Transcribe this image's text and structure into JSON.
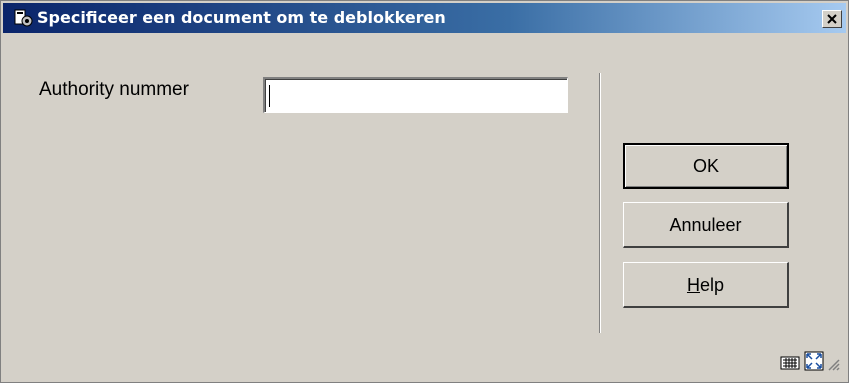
{
  "window": {
    "title": "Specificeer een document om te deblokkeren",
    "icons": {
      "app": "app-icon",
      "close": "close-icon"
    }
  },
  "form": {
    "authority_label": "Authority nummer",
    "authority_value": ""
  },
  "buttons": {
    "ok_label": "OK",
    "cancel_label": "Annuleer",
    "help_mnemonic": "H",
    "help_rest": "elp"
  },
  "statusbar": {
    "icons": [
      "keyboard-icon",
      "maximize-icon",
      "resize-grip-icon"
    ]
  }
}
